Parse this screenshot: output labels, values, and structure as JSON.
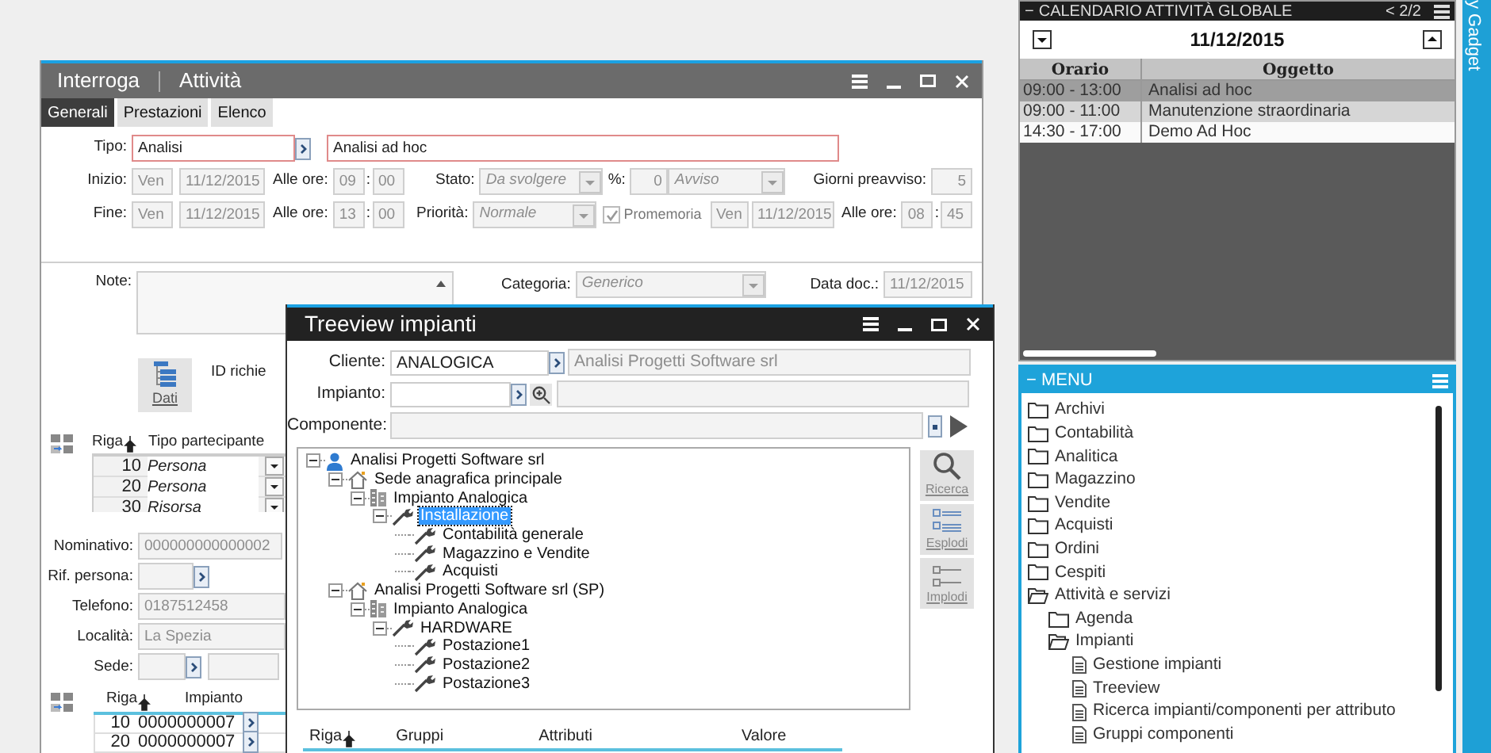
{
  "attivita_window": {
    "mode": "Interroga",
    "title": "Attività",
    "tabs": [
      {
        "label": "Generali",
        "selected": true
      },
      {
        "label": "Prestazioni",
        "selected": false
      },
      {
        "label": "Elenco",
        "selected": false
      }
    ],
    "tipo": {
      "label": "Tipo:",
      "code": "Analisi",
      "description": "Analisi ad hoc"
    },
    "inizio": {
      "label": "Inizio:",
      "day": "Ven",
      "date": "11/12/2015",
      "time_label": "Alle ore:",
      "hour": "09",
      "sep": ":",
      "minute": "00"
    },
    "stato": {
      "label": "Stato:",
      "value": "Da svolgere"
    },
    "percent": {
      "label": "%:",
      "value": "0"
    },
    "avviso": {
      "value": "Avviso"
    },
    "giorni_preavviso": {
      "label": "Giorni preavviso:",
      "value": "5"
    },
    "fine": {
      "label": "Fine:",
      "day": "Ven",
      "date": "11/12/2015",
      "time_label": "Alle ore:",
      "hour": "13",
      "sep": ":",
      "minute": "00"
    },
    "priorita": {
      "label": "Priorità:",
      "value": "Normale"
    },
    "promemoria": {
      "label": "Promemoria",
      "checked": true,
      "day": "Ven",
      "date": "11/12/2015",
      "time_label": "Alle ore:",
      "hour": "08",
      "sep": ":",
      "minute": "45"
    },
    "note": {
      "label": "Note:"
    },
    "categoria": {
      "label": "Categoria:",
      "value": "Generico"
    },
    "data_doc": {
      "label": "Data doc.:",
      "value": "11/12/2015"
    },
    "dati_button": "Dati",
    "id_label": "ID richie",
    "participants": {
      "columns": [
        "Riga",
        "Tipo partecipante"
      ],
      "rows": [
        {
          "riga": "10",
          "tipo": "Persona"
        },
        {
          "riga": "20",
          "tipo": "Persona"
        },
        {
          "riga": "30",
          "tipo": "Risorsa"
        }
      ]
    },
    "nominativo": {
      "label": "Nominativo:",
      "value": "000000000000002"
    },
    "rif_persona": {
      "label": "Rif. persona:"
    },
    "telefono": {
      "label": "Telefono:",
      "value": "0187512458"
    },
    "localita": {
      "label": "Località:",
      "value": "La Spezia"
    },
    "sede": {
      "label": "Sede:"
    },
    "impianti": {
      "columns": [
        "Riga",
        "Impianto"
      ],
      "rows": [
        {
          "riga": "10",
          "impianto": "0000000007"
        },
        {
          "riga": "20",
          "impianto": "0000000007"
        }
      ]
    }
  },
  "treeview_window": {
    "title": "Treeview impianti",
    "cliente": {
      "label": "Cliente:",
      "code": "ANALOGICA",
      "description": "Analisi Progetti Software srl"
    },
    "impianto": {
      "label": "Impianto:"
    },
    "componente": {
      "label": "Componente:"
    },
    "tree": [
      {
        "label": "Analisi Progetti Software srl",
        "kind": "customer",
        "expanded": true,
        "selected": false,
        "children": [
          {
            "label": "Sede anagrafica principale",
            "kind": "site",
            "expanded": true,
            "selected": false,
            "children": [
              {
                "label": "Impianto Analogica",
                "kind": "plant",
                "expanded": true,
                "selected": false,
                "children": [
                  {
                    "label": "Installazione",
                    "kind": "component",
                    "expanded": true,
                    "selected": true,
                    "children": [
                      {
                        "label": "Contabilità generale",
                        "kind": "component",
                        "selected": false
                      },
                      {
                        "label": "Magazzino e Vendite",
                        "kind": "component",
                        "selected": false
                      },
                      {
                        "label": "Acquisti",
                        "kind": "component",
                        "selected": false
                      }
                    ]
                  }
                ]
              }
            ]
          },
          {
            "label": "Analisi Progetti Software srl (SP)",
            "kind": "site",
            "expanded": true,
            "selected": false,
            "children": [
              {
                "label": "Impianto Analogica",
                "kind": "plant",
                "expanded": true,
                "selected": false,
                "children": [
                  {
                    "label": "HARDWARE",
                    "kind": "component",
                    "expanded": true,
                    "selected": false,
                    "children": [
                      {
                        "label": "Postazione1",
                        "kind": "component",
                        "selected": false
                      },
                      {
                        "label": "Postazione2",
                        "kind": "component",
                        "selected": false
                      },
                      {
                        "label": "Postazione3",
                        "kind": "component",
                        "selected": false
                      }
                    ]
                  }
                ]
              }
            ]
          }
        ]
      }
    ],
    "side_buttons": [
      {
        "label": "Ricerca",
        "kind": "search"
      },
      {
        "label": "Esplodi",
        "kind": "expand"
      },
      {
        "label": "Implodi",
        "kind": "collapse"
      }
    ],
    "grid_columns": [
      "Riga",
      "Gruppi",
      "Attributi",
      "Valore"
    ]
  },
  "calendar": {
    "collapse": "−",
    "title": "CALENDARIO ATTIVITÀ GLOBALE",
    "pager": "< 2/2",
    "date": "11/12/2015",
    "columns": [
      "Orario",
      "Oggetto"
    ],
    "rows": [
      {
        "time": "09:00 - 13:00",
        "subject": "Analisi ad hoc",
        "selected": true
      },
      {
        "time": "09:00 - 11:00",
        "subject": "Manutenzione straordinaria",
        "selected": false
      },
      {
        "time": "14:30 - 17:00",
        "subject": "Demo Ad Hoc",
        "selected": false
      }
    ]
  },
  "menu": {
    "collapse": "−",
    "title": "MENU",
    "items": [
      {
        "label": "Archivi",
        "kind": "folder",
        "expanded": false
      },
      {
        "label": "Contabilità",
        "kind": "folder",
        "expanded": false
      },
      {
        "label": "Analitica",
        "kind": "folder",
        "expanded": false
      },
      {
        "label": "Magazzino",
        "kind": "folder",
        "expanded": false
      },
      {
        "label": "Vendite",
        "kind": "folder",
        "expanded": false
      },
      {
        "label": "Acquisti",
        "kind": "folder",
        "expanded": false
      },
      {
        "label": "Ordini",
        "kind": "folder",
        "expanded": false
      },
      {
        "label": "Cespiti",
        "kind": "folder",
        "expanded": false
      },
      {
        "label": "Attività e servizi",
        "kind": "folder",
        "expanded": true,
        "children": [
          {
            "label": "Agenda",
            "kind": "folder",
            "expanded": false
          },
          {
            "label": "Impianti",
            "kind": "folder",
            "expanded": true,
            "children": [
              {
                "label": "Gestione impianti",
                "kind": "document"
              },
              {
                "label": "Treeview",
                "kind": "document"
              },
              {
                "label": "Ricerca impianti/componenti per attributo",
                "kind": "document"
              },
              {
                "label": "Gruppi componenti",
                "kind": "document"
              }
            ]
          }
        ]
      }
    ]
  },
  "gadget_tab": "y Gadget"
}
